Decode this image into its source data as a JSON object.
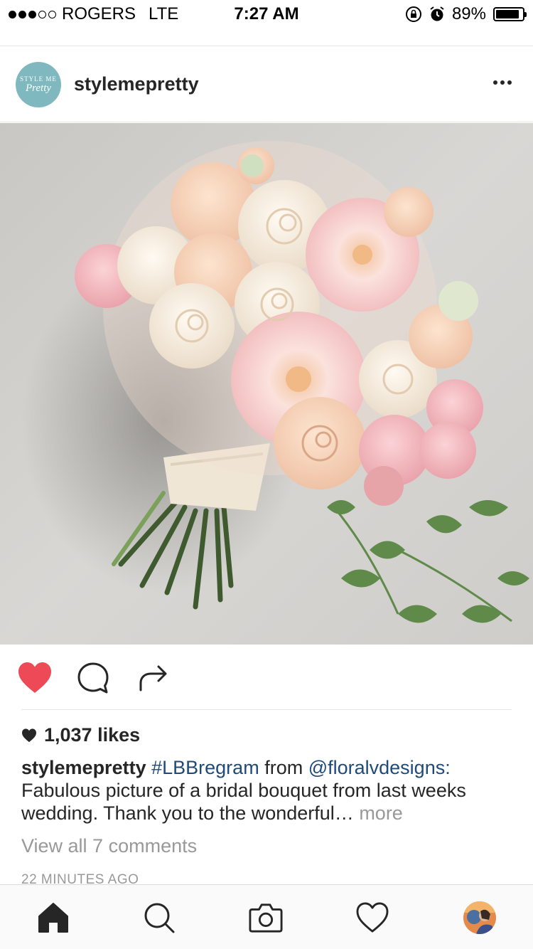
{
  "status_bar": {
    "carrier": "ROGERS",
    "network": "LTE",
    "time": "7:27 AM",
    "battery_text": "89%",
    "battery_level": 0.89,
    "signal_bars_filled": 3,
    "signal_bars_total": 5
  },
  "post": {
    "avatar_text_top": "STYLE ME",
    "avatar_text_bottom": "Pretty",
    "username": "stylemepretty",
    "more_icon": "ellipsis-icon",
    "image_icon": "bridal-bouquet-photo",
    "likes": "1,037 likes",
    "caption": {
      "username": "stylemepretty",
      "hashtag": "#LBBregram",
      "from_word": "from",
      "mention": "@floralvdesigns:",
      "text": "Fabulous picture of a bridal bouquet from last weeks wedding. Thank you to the wonderful…",
      "more": "more"
    },
    "view_comments": "View all 7 comments",
    "timestamp": "22 MINUTES AGO",
    "liked": true
  },
  "colors": {
    "like_red": "#ed4956",
    "link_blue": "#1f4b7a",
    "muted_gray": "#999999",
    "avatar_teal": "#7fb8bf"
  },
  "tabs": [
    {
      "name": "home",
      "icon": "home-icon"
    },
    {
      "name": "search",
      "icon": "search-icon"
    },
    {
      "name": "camera",
      "icon": "camera-icon"
    },
    {
      "name": "activity",
      "icon": "heart-outline-icon"
    },
    {
      "name": "profile",
      "icon": "profile-avatar"
    }
  ]
}
